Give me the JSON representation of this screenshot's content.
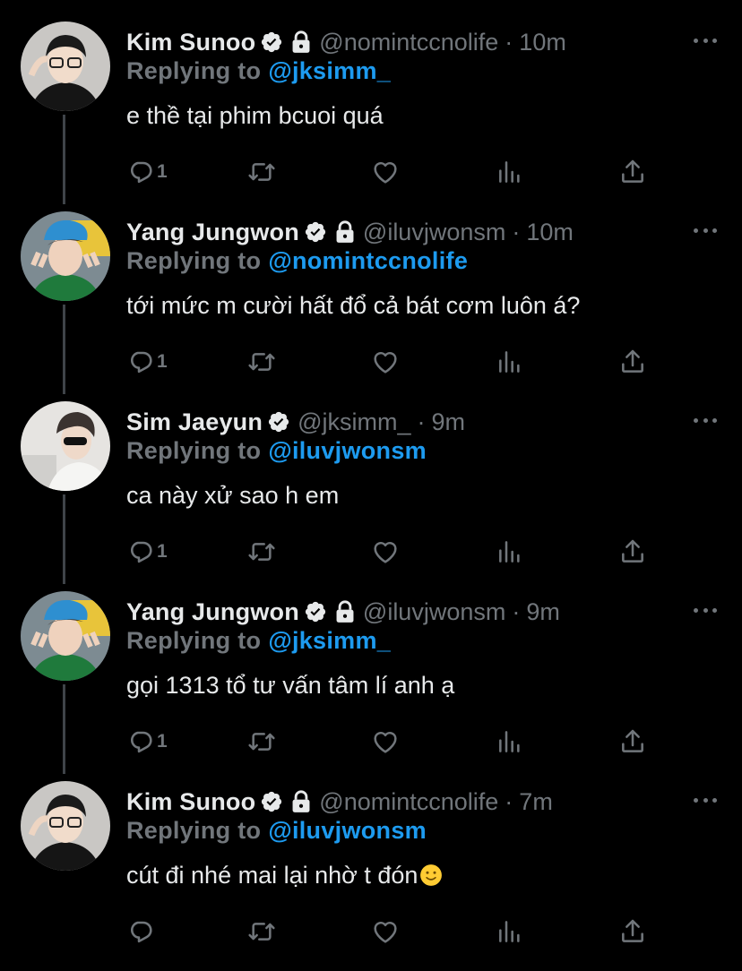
{
  "tweets": [
    {
      "name": "Kim Sunoo",
      "handle": "@nomintccnolife",
      "separator": "·",
      "time": "10m",
      "reply_label": "Replying to",
      "mention": "@jksimm_",
      "text": "e thề tại phim bcuoi quá",
      "reply_count": "1",
      "verified": true,
      "locked": true
    },
    {
      "name": "Yang Jungwon",
      "handle": "@iluvjwonsm",
      "separator": "·",
      "time": "10m",
      "reply_label": "Replying to",
      "mention": "@nomintccnolife",
      "text": "tới mức m cười hất đổ cả bát cơm luôn á?",
      "reply_count": "1",
      "verified": true,
      "locked": true
    },
    {
      "name": "Sim Jaeyun",
      "handle": "@jksimm_",
      "separator": "·",
      "time": "9m",
      "reply_label": "Replying to",
      "mention": "@iluvjwonsm",
      "text": "ca này xử sao h em",
      "reply_count": "1",
      "verified": true,
      "locked": false
    },
    {
      "name": "Yang Jungwon",
      "handle": "@iluvjwonsm",
      "separator": "·",
      "time": "9m",
      "reply_label": "Replying to",
      "mention": "@jksimm_",
      "text": "gọi 1313 tổ tư vấn tâm lí anh ạ",
      "reply_count": "1",
      "verified": true,
      "locked": true
    },
    {
      "name": "Kim Sunoo",
      "handle": "@nomintccnolife",
      "separator": "·",
      "time": "7m",
      "reply_label": "Replying to",
      "mention": "@iluvjwonsm",
      "text": "cút đi nhé mai lại nhờ t đón",
      "reply_count": "",
      "verified": true,
      "locked": true
    }
  ],
  "icons": {
    "verified": "verified-badge-icon",
    "lock": "lock-icon",
    "more": "more-options-icon",
    "reply": "reply-icon",
    "retweet": "retweet-icon",
    "like": "like-heart-icon",
    "stats": "analytics-icon",
    "share": "share-icon",
    "emoji": "slightly-smiling-face-icon"
  },
  "colors": {
    "background": "#000000",
    "text": "#e7e9ea",
    "secondary": "#71767b",
    "accent": "#1d9bf0",
    "thread_line": "#3f4449"
  }
}
